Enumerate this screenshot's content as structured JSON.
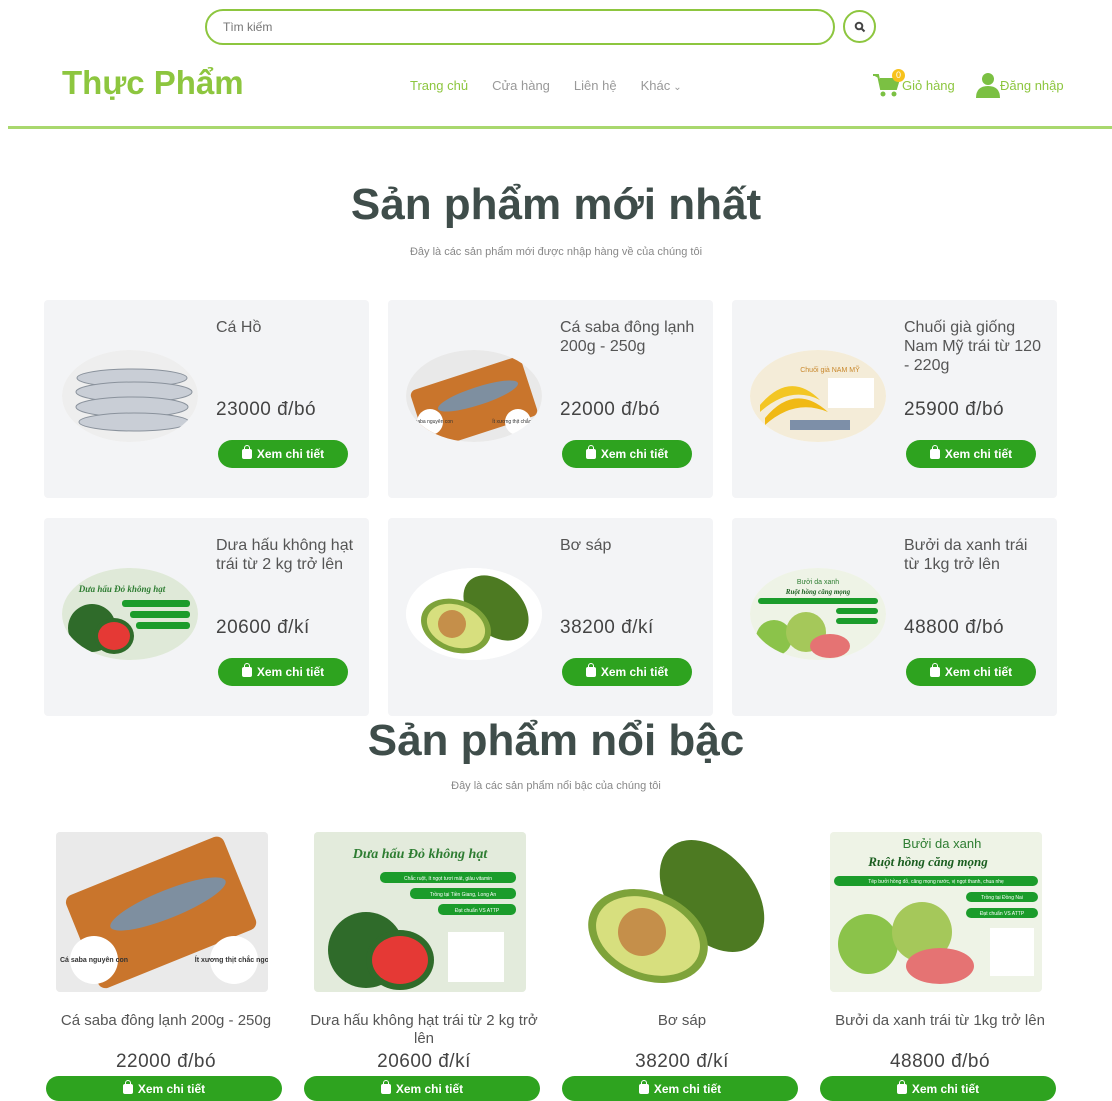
{
  "search": {
    "placeholder": "Tìm kiếm"
  },
  "header": {
    "logo": "Thực Phẩm",
    "nav": [
      "Trang chủ",
      "Cửa hàng",
      "Liên hệ",
      "Khác"
    ],
    "cart_label": "Giỏ hàng",
    "cart_count": "0",
    "login_label": "Đăng nhập"
  },
  "newest": {
    "title": "Sản phẩm mới nhất",
    "subtitle": "Đây là các sản phẩm mới được nhập hàng về của chúng tôi",
    "products": [
      {
        "name": "Cá Hồ",
        "price": "23000 đ/bó",
        "button": "Xem chi tiết"
      },
      {
        "name": "Cá saba đông lạnh 200g - 250g",
        "price": "22000 đ/bó",
        "button": "Xem chi tiết"
      },
      {
        "name": "Chuối già giống Nam Mỹ trái từ 120 - 220g",
        "price": "25900 đ/bó",
        "button": "Xem chi tiết"
      },
      {
        "name": "Dưa hấu không hạt trái từ 2 kg trở lên",
        "price": "20600 đ/kí",
        "button": "Xem chi tiết"
      },
      {
        "name": "Bơ sáp",
        "price": "38200 đ/kí",
        "button": "Xem chi tiết"
      },
      {
        "name": "Bưởi da xanh trái từ 1kg trở lên",
        "price": "48800 đ/bó",
        "button": "Xem chi tiết"
      }
    ]
  },
  "featured": {
    "title": "Sản phẩm nổi bậc",
    "subtitle": "Đây là các sản phẩm nổi bậc của chúng tôi",
    "products": [
      {
        "name": "Cá saba đông lạnh 200g - 250g",
        "price": "22000 đ/bó",
        "button": "Xem chi tiết"
      },
      {
        "name": "Dưa hấu không hạt trái từ 2 kg trở lên",
        "price": "20600 đ/kí",
        "button": "Xem chi tiết"
      },
      {
        "name": "Bơ sáp",
        "price": "38200 đ/kí",
        "button": "Xem chi tiết"
      },
      {
        "name": "Bưởi da xanh trái từ 1kg trở lên",
        "price": "48800 đ/bó",
        "button": "Xem chi tiết"
      }
    ]
  },
  "image_text": {
    "saba_left": "Cá saba nguyên con",
    "saba_right": "Ít xương thịt chắc ngon",
    "banana": "Chuối già NAM MỸ",
    "watermelon": "Dưa hấu Đỏ không hạt",
    "watermelon_1": "Chắc ruột, ít ngọt tươi mát, giàu vitamin",
    "watermelon_2": "Trồng tại Tiền Giang, Long An",
    "watermelon_3": "Đạt chuẩn VS ATTP",
    "pomelo_1": "Bưởi da xanh",
    "pomelo_2": "Ruột hồng căng mọng",
    "pomelo_3": "Tép bưởi hồng đỏ, căng mọng nước, vị ngọt thanh, chua nhẹ",
    "pomelo_4": "Trồng tại Đồng Nai",
    "pomelo_5": "Đạt chuẩn VS ATTP"
  },
  "colors": {
    "brand": "#8dc63f",
    "button": "#2ea31f",
    "card_bg": "#f3f4f6"
  }
}
